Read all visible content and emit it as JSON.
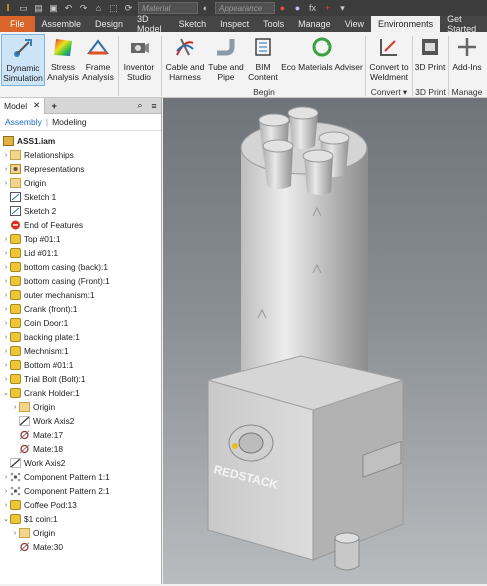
{
  "qat": {
    "material_field": "Material",
    "appearance_field": "Appearance",
    "fx": "fx"
  },
  "tabs": [
    "File",
    "Assemble",
    "Design",
    "3D Model",
    "Sketch",
    "Inspect",
    "Tools",
    "Manage",
    "View",
    "Environments",
    "Get Started"
  ],
  "ribbon": {
    "buttons": [
      {
        "l1": "Dynamic",
        "l2": "Simulation"
      },
      {
        "l1": "Stress",
        "l2": "Analysis"
      },
      {
        "l1": "Frame",
        "l2": "Analysis"
      },
      {
        "l1": "Inventor",
        "l2": "Studio"
      },
      {
        "l1": "Cable and",
        "l2": "Harness"
      },
      {
        "l1": "Tube and",
        "l2": "Pipe"
      },
      {
        "l1": "BIM",
        "l2": "Content"
      },
      {
        "l1": "Eco Materials Adviser",
        "l2": ""
      },
      {
        "l1": "Convert to",
        "l2": "Weldment"
      },
      {
        "l1": "3D Print",
        "l2": ""
      },
      {
        "l1": "Add-Ins",
        "l2": ""
      }
    ],
    "panels": {
      "begin": "Begin",
      "convert": "Convert ▾",
      "print": "3D Print",
      "manage": "Manage"
    }
  },
  "browser": {
    "tab": "Model",
    "sub_assembly": "Assembly",
    "sub_modeling": "Modeling",
    "root": "ASS1.iam",
    "items": [
      {
        "label": "Relationships",
        "icon": "relationships"
      },
      {
        "label": "Representations",
        "icon": "representations"
      },
      {
        "label": "Origin",
        "icon": "folder"
      },
      {
        "label": "Sketch 1",
        "icon": "sketch"
      },
      {
        "label": "Sketch 2",
        "icon": "sketch"
      },
      {
        "label": "End of Features",
        "icon": "stop"
      },
      {
        "label": "Top #01:1",
        "icon": "part"
      },
      {
        "label": "Lid #01:1",
        "icon": "part"
      },
      {
        "label": "bottom casing (back):1",
        "icon": "part"
      },
      {
        "label": "bottom casing (Front):1",
        "icon": "part"
      },
      {
        "label": "outer mechanism:1",
        "icon": "part"
      },
      {
        "label": "Crank (front):1",
        "icon": "part"
      },
      {
        "label": "Coin Door:1",
        "icon": "part"
      },
      {
        "label": "backing plate:1",
        "icon": "part"
      },
      {
        "label": "Mechnism:1",
        "icon": "part"
      },
      {
        "label": "Bottom #01:1",
        "icon": "part"
      },
      {
        "label": "Trial Bolt (Bolt):1",
        "icon": "part"
      },
      {
        "label": "Crank Holder:1",
        "icon": "part"
      },
      {
        "label": "Origin",
        "icon": "folder"
      },
      {
        "label": "Work Axis2",
        "icon": "workaxis"
      },
      {
        "label": "Mate:17",
        "icon": "mate"
      },
      {
        "label": "Mate:18",
        "icon": "mate"
      },
      {
        "label": "Work Axis2",
        "icon": "workaxis"
      },
      {
        "label": "Component Pattern 1:1",
        "icon": "pattern"
      },
      {
        "label": "Component Pattern 2:1",
        "icon": "pattern"
      },
      {
        "label": "Coffee Pod:13",
        "icon": "part"
      },
      {
        "label": "$1 coin:1",
        "icon": "part"
      },
      {
        "label": "Origin",
        "icon": "folder"
      },
      {
        "label": "Mate:30",
        "icon": "mate"
      }
    ]
  },
  "model": {
    "logo_text": "REDSTACK"
  }
}
